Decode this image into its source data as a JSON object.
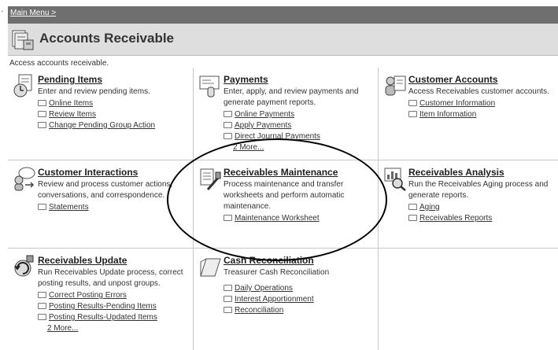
{
  "breadcrumb": {
    "label": "Main Menu >"
  },
  "page": {
    "title": "Accounts Receivable",
    "description": "Access accounts receivable."
  },
  "tiles": {
    "pending_items": {
      "title": "Pending Items",
      "description": "Enter and review pending items.",
      "links": [
        "Online Items",
        "Review Items",
        "Change Pending Group Action"
      ]
    },
    "payments": {
      "title": "Payments",
      "description": "Enter, apply, and review payments and generate payment reports.",
      "links": [
        "Online Payments",
        "Apply Payments",
        "Direct Journal Payments"
      ],
      "more": "2 More..."
    },
    "customer_accounts": {
      "title": "Customer Accounts",
      "description": "Access Receivables customer accounts.",
      "links": [
        "Customer Information",
        "Item Information"
      ]
    },
    "customer_interactions": {
      "title": "Customer Interactions",
      "description": "Review and process customer actions, conversations, and correspondence.",
      "links": [
        "Statements"
      ]
    },
    "receivables_maintenance": {
      "title": "Receivables Maintenance",
      "description": "Process maintenance and transfer worksheets and perform automatic maintenance.",
      "links": [
        "Maintenance Worksheet"
      ]
    },
    "receivables_analysis": {
      "title": "Receivables Analysis",
      "description": "Run the Receivables Aging process and generate reports.",
      "links": [
        "Aging",
        "Receivables Reports"
      ]
    },
    "receivables_update": {
      "title": "Receivables Update",
      "description": "Run Receivables Update process, correct posting results, and unpost groups.",
      "links": [
        "Correct Posting Errors",
        "Posting Results-Pending Items",
        "Posting Results-Updated Items"
      ],
      "more": "2 More..."
    },
    "cash_reconciliation": {
      "title": "Cash Reconciliation",
      "description": "Treasurer Cash Reconciliation",
      "links": [
        "Daily Operations",
        "Interest Apportionment",
        "Reconciliation"
      ]
    }
  }
}
